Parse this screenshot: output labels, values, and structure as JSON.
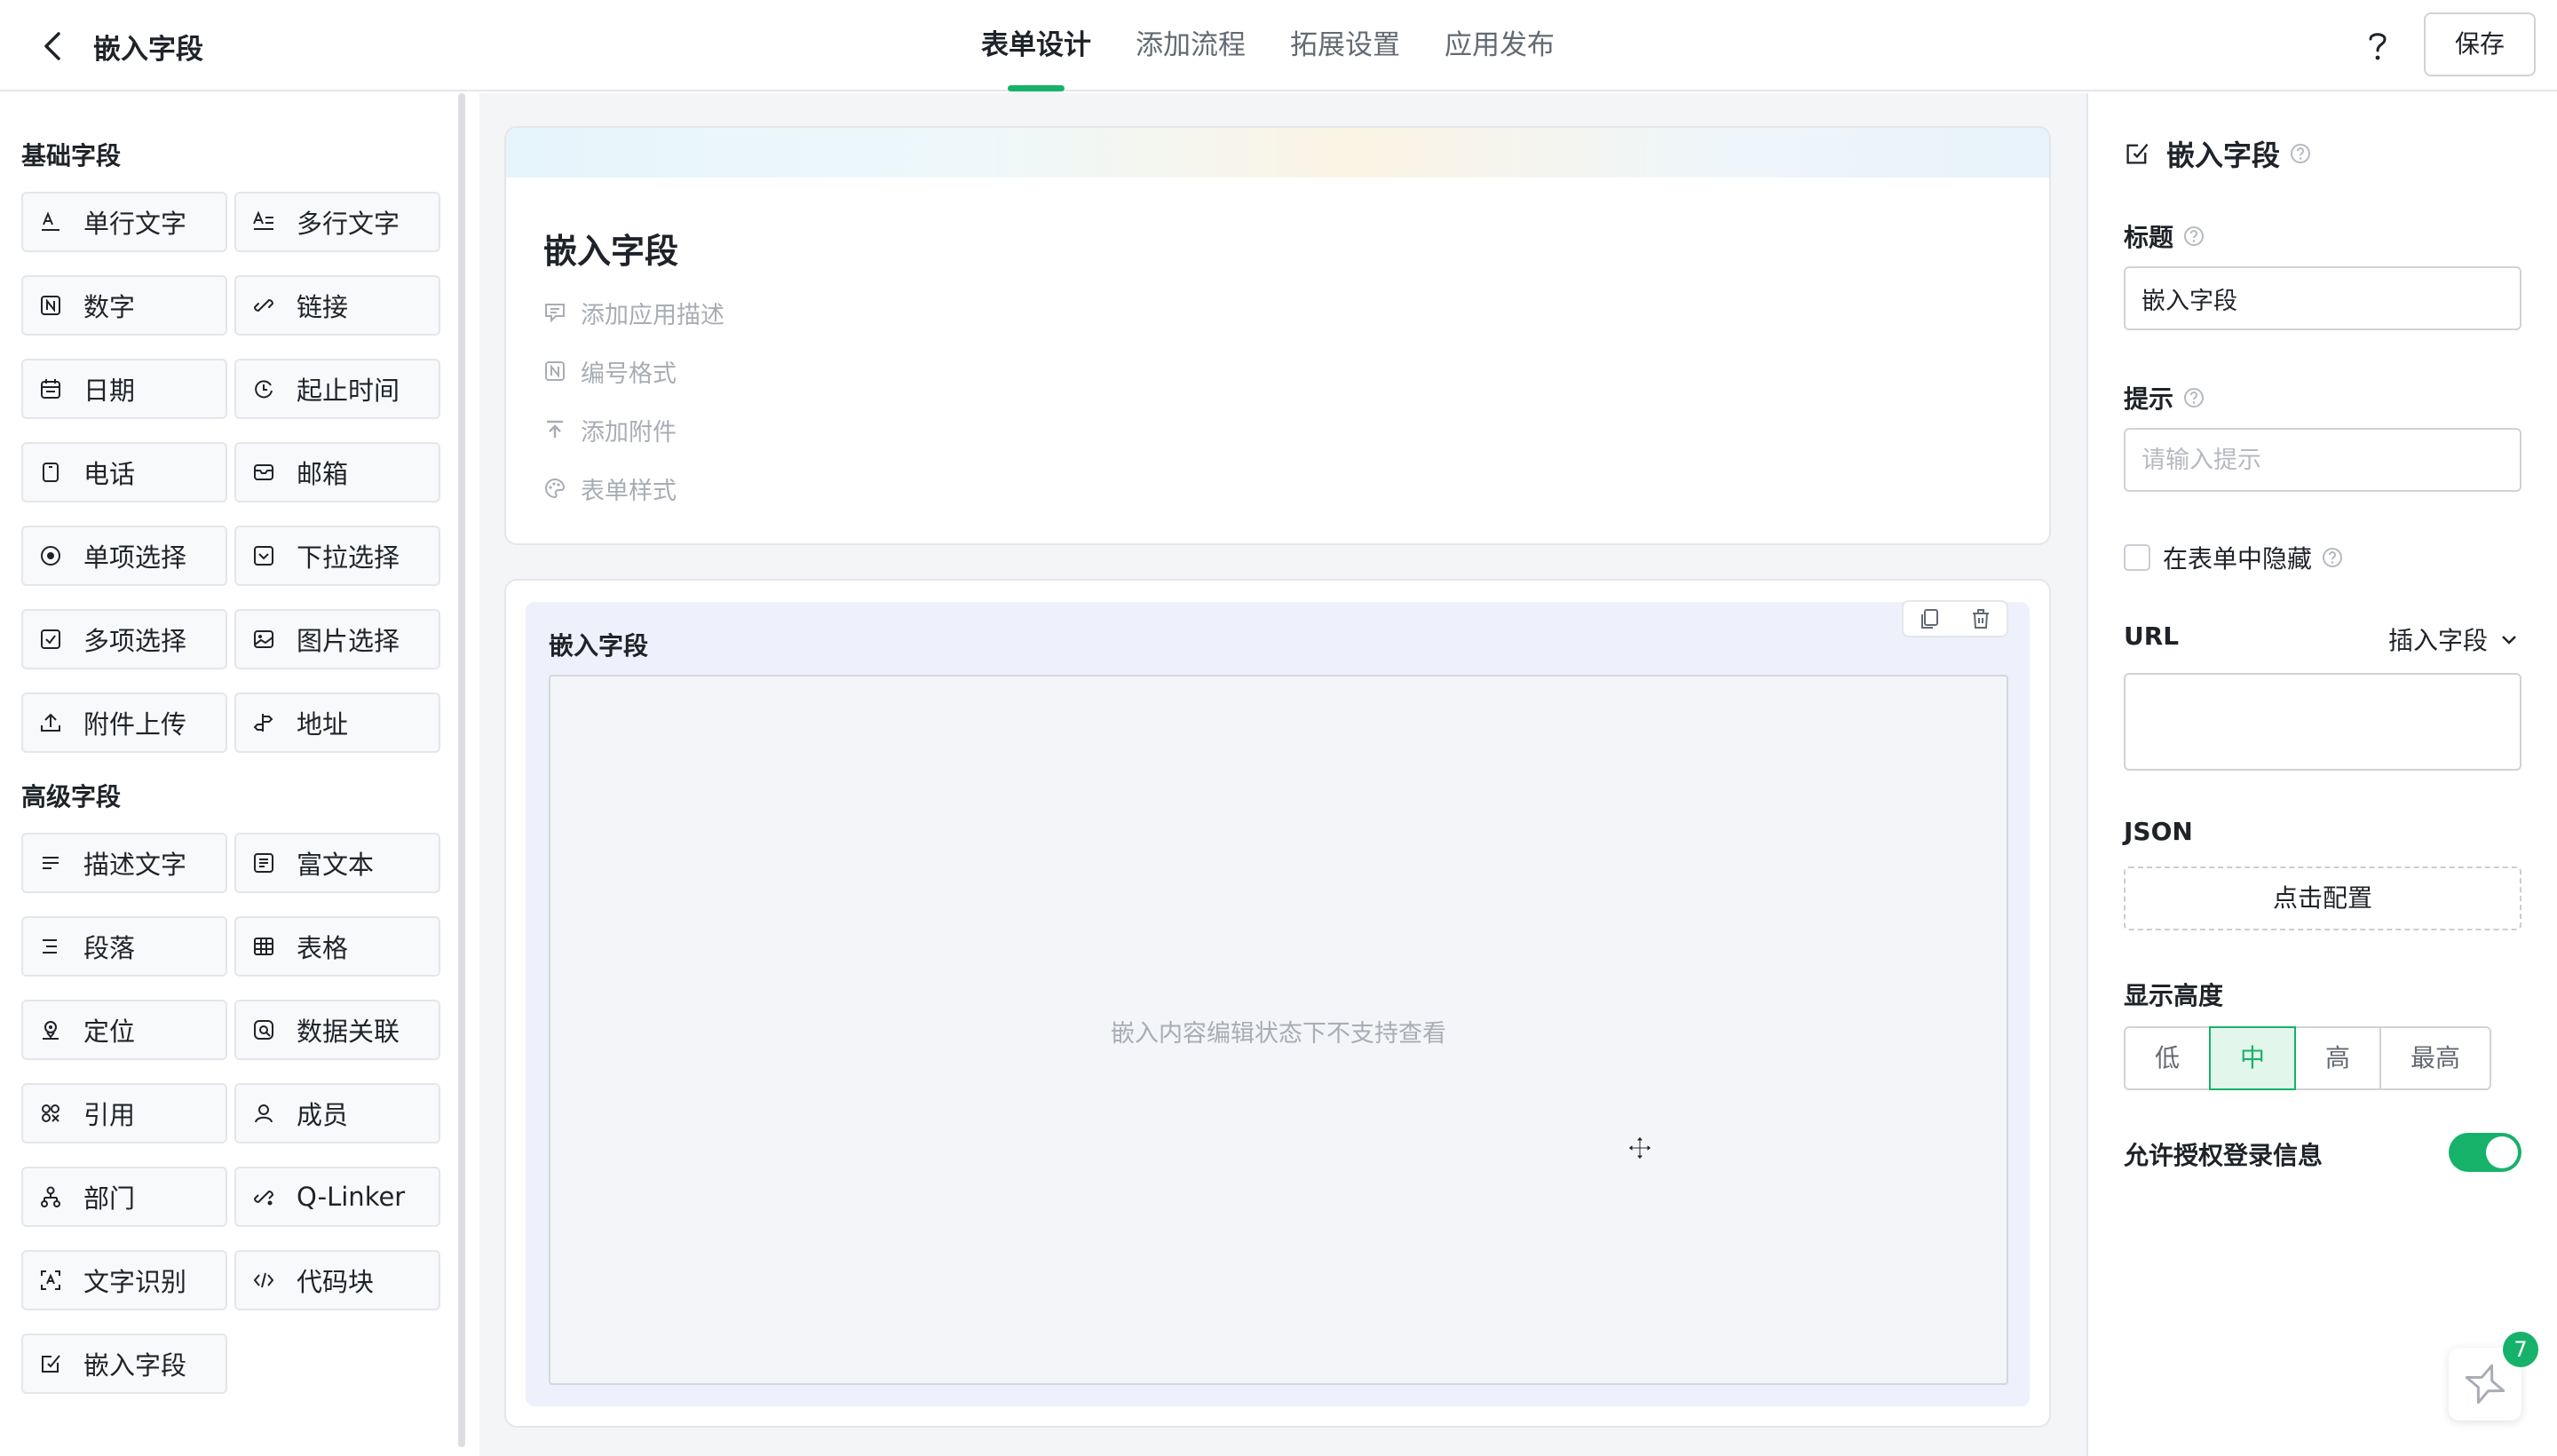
{
  "header": {
    "title": "嵌入字段",
    "tabs": [
      {
        "label": "表单设计",
        "active": true
      },
      {
        "label": "添加流程",
        "active": false
      },
      {
        "label": "拓展设置",
        "active": false
      },
      {
        "label": "应用发布",
        "active": false
      }
    ],
    "save_label": "保存"
  },
  "sidebar": {
    "basic_title": "基础字段",
    "basic_fields": [
      {
        "label": "单行文字",
        "icon": "single-line-text-icon"
      },
      {
        "label": "多行文字",
        "icon": "multi-line-text-icon"
      },
      {
        "label": "数字",
        "icon": "number-icon"
      },
      {
        "label": "链接",
        "icon": "link-icon"
      },
      {
        "label": "日期",
        "icon": "calendar-icon"
      },
      {
        "label": "起止时间",
        "icon": "time-range-icon"
      },
      {
        "label": "电话",
        "icon": "phone-icon"
      },
      {
        "label": "邮箱",
        "icon": "mail-icon"
      },
      {
        "label": "单项选择",
        "icon": "radio-icon"
      },
      {
        "label": "下拉选择",
        "icon": "dropdown-icon"
      },
      {
        "label": "多项选择",
        "icon": "checkbox-icon"
      },
      {
        "label": "图片选择",
        "icon": "image-icon"
      },
      {
        "label": "附件上传",
        "icon": "upload-icon"
      },
      {
        "label": "地址",
        "icon": "signpost-icon"
      }
    ],
    "advanced_title": "高级字段",
    "advanced_fields": [
      {
        "label": "描述文字",
        "icon": "description-icon"
      },
      {
        "label": "富文本",
        "icon": "rich-text-icon"
      },
      {
        "label": "段落",
        "icon": "paragraph-icon"
      },
      {
        "label": "表格",
        "icon": "table-icon"
      },
      {
        "label": "定位",
        "icon": "location-icon"
      },
      {
        "label": "数据关联",
        "icon": "data-link-icon"
      },
      {
        "label": "引用",
        "icon": "reference-icon"
      },
      {
        "label": "成员",
        "icon": "member-icon"
      },
      {
        "label": "部门",
        "icon": "department-icon"
      },
      {
        "label": "Q-Linker",
        "icon": "q-linker-icon"
      },
      {
        "label": "文字识别",
        "icon": "ocr-icon"
      },
      {
        "label": "代码块",
        "icon": "code-icon"
      },
      {
        "label": "嵌入字段",
        "icon": "embed-icon"
      }
    ]
  },
  "form": {
    "title": "嵌入字段",
    "options": [
      {
        "label": "添加应用描述",
        "icon": "comment-icon"
      },
      {
        "label": "编号格式",
        "icon": "number-format-icon"
      },
      {
        "label": "添加附件",
        "icon": "attachment-upload-icon"
      },
      {
        "label": "表单样式",
        "icon": "palette-icon"
      }
    ]
  },
  "embed_field": {
    "label": "嵌入字段",
    "placeholder": "嵌入内容编辑状态下不支持查看"
  },
  "properties": {
    "heading": "嵌入字段",
    "title_label": "标题",
    "title_value": "嵌入字段",
    "hint_label": "提示",
    "hint_placeholder": "请输入提示",
    "hide_label": "在表单中隐藏",
    "hide_checked": false,
    "url_label": "URL",
    "insert_field_label": "插入字段",
    "json_label": "JSON",
    "config_label": "点击配置",
    "height_label": "显示高度",
    "height_options": [
      "低",
      "中",
      "高",
      "最高"
    ],
    "height_selected": "中",
    "auth_label": "允许授权登录信息",
    "auth_enabled": true
  },
  "assistant": {
    "badge": "7"
  },
  "colors": {
    "accent": "#17b26a",
    "text": "#1f2329",
    "muted": "#a8adb5",
    "border": "#d0d3d6"
  }
}
